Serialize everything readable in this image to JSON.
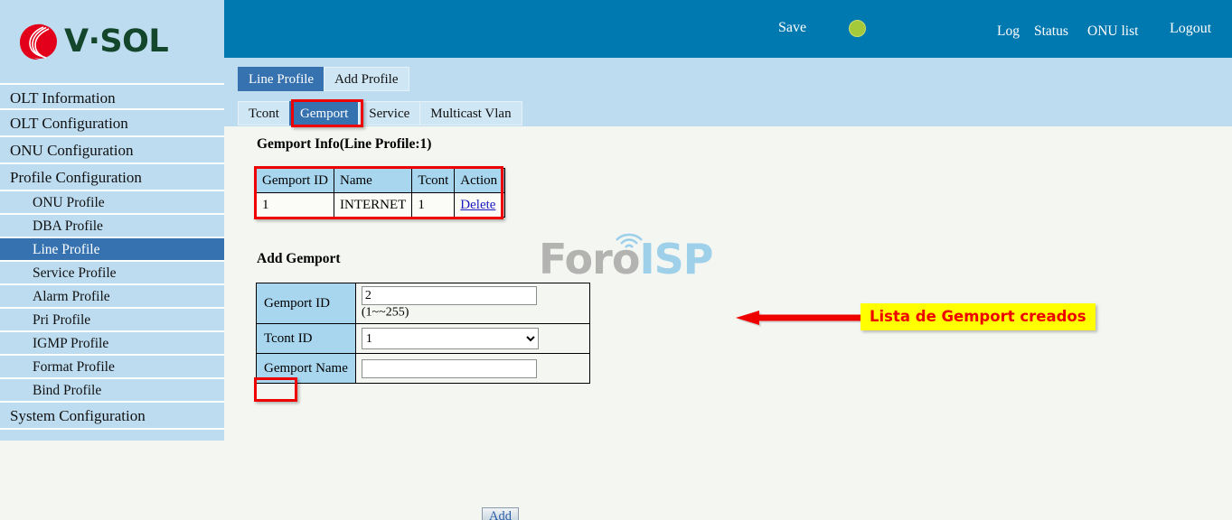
{
  "brand": {
    "logo_text_v": "V",
    "logo_text_dot": "·",
    "logo_text_sol": "SOL",
    "logo_name": "V·SOL",
    "accent_header": "#0078b0",
    "accent_active": "#3672b0",
    "accent_sidebar": "#bddcf0",
    "annotation_red": "#ee0000",
    "annotation_yellow": "#ffff00"
  },
  "header": {
    "save_label": "Save",
    "status_dot_color": "#a4c93a",
    "links": [
      {
        "label": "Log"
      },
      {
        "label": "Status"
      },
      {
        "label": "ONU list"
      },
      {
        "label": "Logout"
      }
    ]
  },
  "sidebar": {
    "items": [
      {
        "label": "OLT Information",
        "level": 0,
        "active": false
      },
      {
        "label": "OLT Configuration",
        "level": 0,
        "active": false
      },
      {
        "label": "ONU Configuration",
        "level": 0,
        "active": false
      },
      {
        "label": "Profile Configuration",
        "level": 0,
        "active": false
      },
      {
        "label": "ONU Profile",
        "level": 1,
        "active": false
      },
      {
        "label": "DBA Profile",
        "level": 1,
        "active": false
      },
      {
        "label": "Line Profile",
        "level": 1,
        "active": true
      },
      {
        "label": "Service Profile",
        "level": 1,
        "active": false
      },
      {
        "label": "Alarm Profile",
        "level": 1,
        "active": false
      },
      {
        "label": "Pri Profile",
        "level": 1,
        "active": false
      },
      {
        "label": "IGMP Profile",
        "level": 1,
        "active": false
      },
      {
        "label": "Format Profile",
        "level": 1,
        "active": false
      },
      {
        "label": "Bind Profile",
        "level": 1,
        "active": false
      },
      {
        "label": "System Configuration",
        "level": 0,
        "active": false
      }
    ]
  },
  "tabs": {
    "primary": [
      {
        "label": "Line Profile",
        "active": true
      },
      {
        "label": "Add Profile",
        "active": false
      }
    ],
    "secondary": [
      {
        "label": "Tcont",
        "active": false
      },
      {
        "label": "Gemport",
        "active": true
      },
      {
        "label": "Service",
        "active": false
      },
      {
        "label": "Multicast Vlan",
        "active": false
      }
    ]
  },
  "main": {
    "info_title": "Gemport Info(Line Profile:1)",
    "info_table": {
      "columns": [
        "Gemport ID",
        "Name",
        "Tcont",
        "Action"
      ],
      "rows": [
        {
          "gemport_id": "1",
          "name": "INTERNET",
          "tcont": "1",
          "action": "Delete"
        }
      ]
    },
    "add_title": "Add Gemport",
    "form": {
      "gemport_id_label": "Gemport ID",
      "gemport_id_value": "2",
      "gemport_id_hint": "(1~~255)",
      "tcont_id_label": "Tcont ID",
      "tcont_id_value": "1",
      "tcont_id_options": [
        "1"
      ],
      "gemport_name_label": "Gemport Name",
      "gemport_name_value": "",
      "gemport_name_placeholder": ""
    },
    "add_button_label": "Add"
  },
  "annotation": {
    "text": "Lista de Gemport creados"
  },
  "watermark": {
    "part1": "Foro",
    "part2": "ISP"
  }
}
